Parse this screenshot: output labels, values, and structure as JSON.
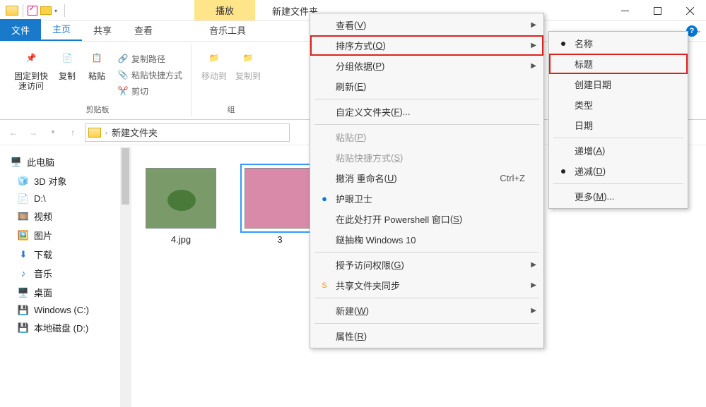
{
  "titlebar": {
    "context_tab": "播放",
    "window_title": "新建文件夹"
  },
  "tabs": {
    "file": "文件",
    "home": "主页",
    "share": "共享",
    "view": "查看",
    "music": "音乐工具"
  },
  "ribbon": {
    "pin": "固定到快\n速访问",
    "copy": "复制",
    "paste": "粘贴",
    "copypath": "复制路径",
    "pasteshortcut": "粘贴快捷方式",
    "cut": "剪切",
    "clipboard_group": "剪贴板",
    "moveto": "移动到",
    "copyto": "复制到"
  },
  "address": {
    "folder": "新建文件夹"
  },
  "sidebar": {
    "root": "此电脑",
    "items": [
      "3D 对象",
      "D:\\",
      "视频",
      "图片",
      "下载",
      "音乐",
      "桌面",
      "Windows (C:)",
      "本地磁盘 (D:)"
    ]
  },
  "files": {
    "f1_name": "4.jpg",
    "f2_name": "3"
  },
  "ctx_main": {
    "view": "查看",
    "view_accel": "V",
    "sort": "排序方式",
    "sort_accel": "O",
    "group": "分组依据",
    "group_accel": "P",
    "refresh": "刷新",
    "refresh_accel": "E",
    "customize": "自定义文件夹",
    "customize_accel": "F",
    "paste": "粘贴",
    "paste_accel": "P",
    "pasteshort": "粘贴快捷方式",
    "pasteshort_accel": "S",
    "undo": "撤消 重命名",
    "undo_accel": "U",
    "undo_shortcut": "Ctrl+Z",
    "eyeguard": "护眼卫士",
    "powershell": "在此处打开 Powershell 窗口",
    "powershell_accel": "S",
    "win10": "鎹抽椈 Windows 10",
    "perm": "授予访问权限",
    "perm_accel": "G",
    "sharesync": "共享文件夹同步",
    "new": "新建",
    "new_accel": "W",
    "props": "属性",
    "props_accel": "R"
  },
  "ctx_sub": {
    "name": "名称",
    "title": "标题",
    "created": "创建日期",
    "type": "类型",
    "date": "日期",
    "asc": "递增",
    "asc_accel": "A",
    "desc": "递减",
    "desc_accel": "D",
    "more": "更多",
    "more_accel": "M"
  }
}
